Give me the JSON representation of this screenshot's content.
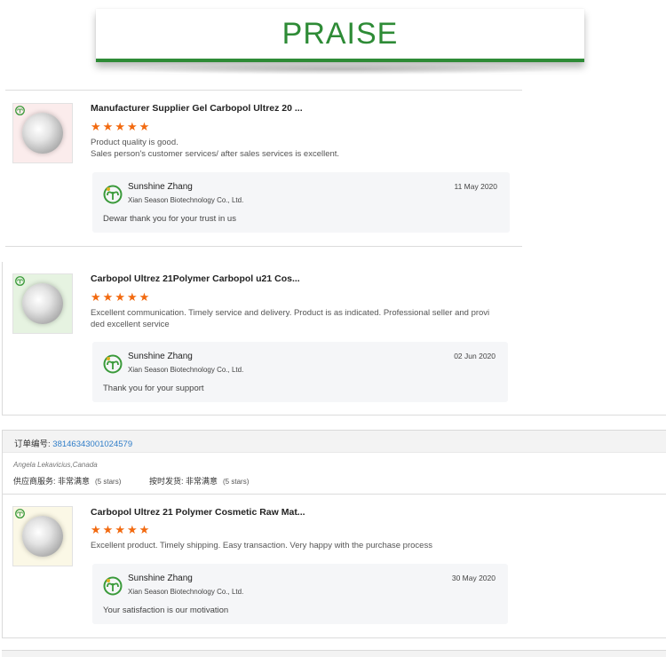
{
  "banner": {
    "title": "PRAISE"
  },
  "reviews": [
    {
      "product_title": "Manufacturer Supplier Gel Carbopol Ultrez 20 ...",
      "stars": 5,
      "text_lines": [
        "Product quality is good.",
        "Sales person's customer services/ after sales services is excellent."
      ],
      "thumb_bg": "#fbecec",
      "reply": {
        "name": "Sunshine Zhang",
        "company": "Xian Season Biotechnology Co., Ltd.",
        "date": "11 May 2020",
        "text": "Dewar thank you for your trust in us"
      }
    },
    {
      "product_title": "Carbopol Ultrez 21Polymer Carbopol u21 Cos...",
      "stars": 5,
      "text_lines": [
        "Excellent communication. Timely service and delivery. Product is as indicated. Professional seller and provi",
        "ded excellent service"
      ],
      "thumb_bg": "#e6f3e1",
      "reply": {
        "name": "Sunshine Zhang",
        "company": "Xian Season Biotechnology Co., Ltd.",
        "date": "02 Jun 2020",
        "text": "Thank you for your support"
      }
    },
    {
      "product_title": "Carbopol Ultrez 21 Polymer Cosmetic Raw Mat...",
      "stars": 5,
      "text_lines": [
        "Excellent product. Timely shipping. Easy transaction. Very happy with the purchase process"
      ],
      "thumb_bg": "#fbf8e6",
      "reply": {
        "name": "Sunshine Zhang",
        "company": "Xian Season Biotechnology Co., Ltd.",
        "date": "30 May 2020",
        "text": "Your satisfaction is our motivation"
      }
    }
  ],
  "order": {
    "label": "订单编号: ",
    "number": "38146343001024579",
    "buyer": "Angela Lekavicius,Canada",
    "service_label": "供应商服务: 非常满意",
    "service_stars": "(5 stars)",
    "shipping_label": "按时发货: 非常满意",
    "shipping_stars": "(5 stars)"
  },
  "colors": {
    "brand_green": "#2e8b36",
    "star_orange": "#f26a10",
    "link_blue": "#2f7dc8"
  }
}
